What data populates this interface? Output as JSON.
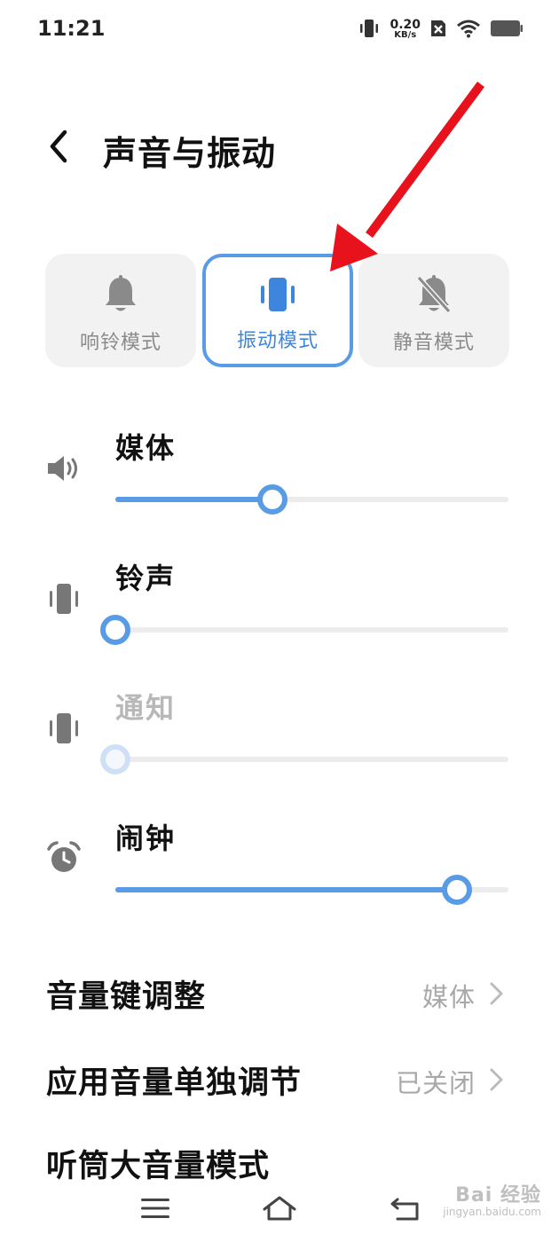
{
  "status_bar": {
    "time": "11:21",
    "net_speed_value": "0.20",
    "net_speed_unit": "KB/s",
    "icons": [
      "vibrate-icon",
      "sim-disabled-icon",
      "wifi-icon",
      "battery-icon"
    ]
  },
  "header": {
    "title": "声音与振动",
    "back_icon": "back-chevron-icon"
  },
  "modes": [
    {
      "label": "响铃模式",
      "icon": "bell-icon",
      "selected": false
    },
    {
      "label": "振动模式",
      "icon": "vibrate-icon",
      "selected": true
    },
    {
      "label": "静音模式",
      "icon": "bell-off-icon",
      "selected": false
    }
  ],
  "volumes": [
    {
      "label": "媒体",
      "icon": "speaker-icon",
      "level": 0.4,
      "enabled": true
    },
    {
      "label": "铃声",
      "icon": "vibrate-icon",
      "level": 0.0,
      "enabled": true
    },
    {
      "label": "通知",
      "icon": "vibrate-icon",
      "level": 0.0,
      "enabled": false
    },
    {
      "label": "闹钟",
      "icon": "alarm-icon",
      "level": 0.87,
      "enabled": true
    }
  ],
  "settings": [
    {
      "title": "音量键调整",
      "value": "媒体"
    },
    {
      "title": "应用音量单独调节",
      "value": "已关闭"
    },
    {
      "title": "听筒大音量模式",
      "value": ""
    }
  ],
  "nav": {
    "icons": [
      "menu-icon",
      "home-icon",
      "back-icon"
    ]
  },
  "watermark": {
    "main": "Bai 经验",
    "sub": "jingyan.baidu.com"
  },
  "colors": {
    "accent": "#5a9be6",
    "annotation_arrow": "#e8121c"
  }
}
